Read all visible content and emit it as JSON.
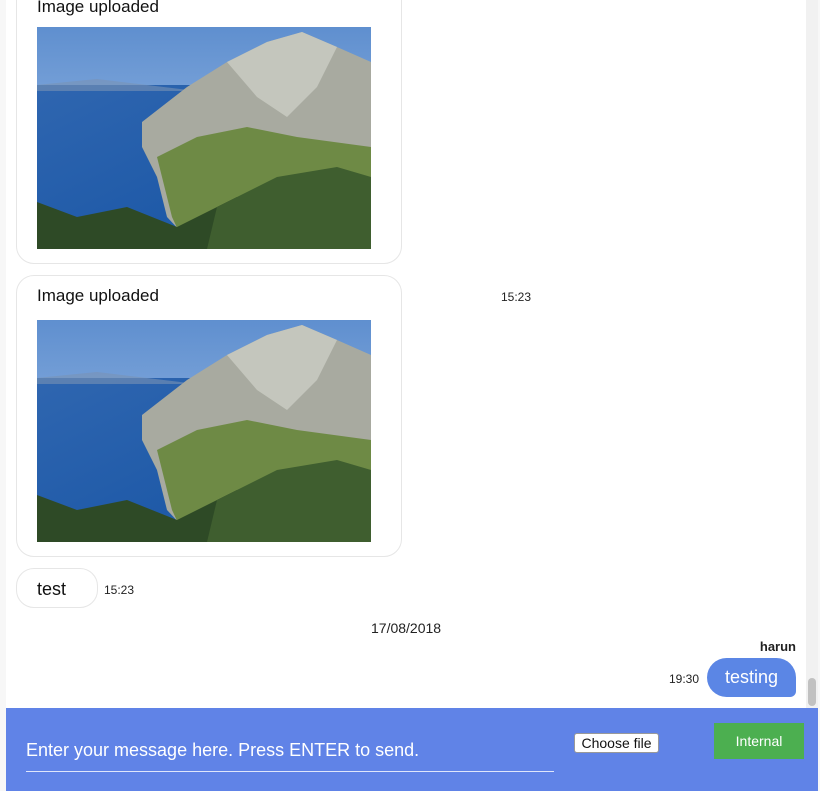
{
  "messages": {
    "first_image": {
      "title": "Image uploaded"
    },
    "second_image": {
      "title": "Image uploaded",
      "time": "15:23"
    },
    "text_message": {
      "text": "test",
      "time": "15:23"
    },
    "date_separator": "17/08/2018",
    "outgoing": {
      "sender": "harun",
      "text": "testing",
      "time": "19:30"
    }
  },
  "composer": {
    "placeholder": "Enter your message here. Press ENTER to send.",
    "file_button_label": "Choose file",
    "internal_button_label": "Internal"
  },
  "colors": {
    "composer_bg": "#6083e7",
    "outgoing_bubble": "#5b86e5",
    "internal_button": "#4caf50"
  },
  "icons": {
    "photo": "landscape-photo"
  }
}
